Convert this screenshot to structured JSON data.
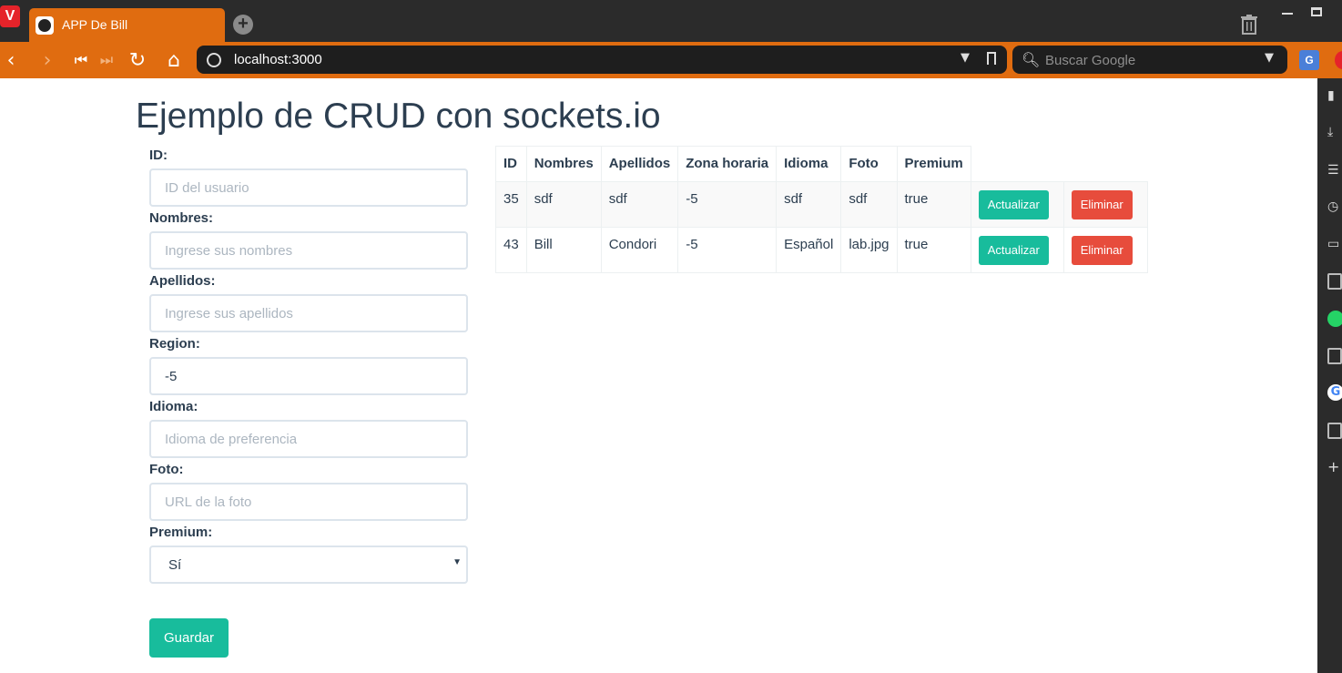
{
  "browser": {
    "tab_title": "APP De Bill",
    "url": "localhost:3000",
    "search_placeholder": "Buscar Google"
  },
  "page": {
    "title": "Ejemplo de CRUD con sockets.io"
  },
  "form": {
    "id": {
      "label": "ID:",
      "placeholder": "ID del usuario",
      "value": ""
    },
    "nombres": {
      "label": "Nombres:",
      "placeholder": "Ingrese sus nombres",
      "value": ""
    },
    "apellidos": {
      "label": "Apellidos:",
      "placeholder": "Ingrese sus apellidos",
      "value": ""
    },
    "region": {
      "label": "Region:",
      "placeholder": "",
      "value": "-5"
    },
    "idioma": {
      "label": "Idioma:",
      "placeholder": "Idioma de preferencia",
      "value": ""
    },
    "foto": {
      "label": "Foto:",
      "placeholder": "URL de la foto",
      "value": ""
    },
    "premium": {
      "label": "Premium:",
      "selected": "Sí"
    },
    "save_label": "Guardar"
  },
  "table": {
    "headers": [
      "ID",
      "Nombres",
      "Apellidos",
      "Zona horaria",
      "Idioma",
      "Foto",
      "Premium"
    ],
    "rows": [
      {
        "id": "35",
        "nombres": "sdf",
        "apellidos": "sdf",
        "zona": "-5",
        "idioma": "sdf",
        "foto": "sdf",
        "premium": "true"
      },
      {
        "id": "43",
        "nombres": "Bill",
        "apellidos": "Condori",
        "zona": "-5",
        "idioma": "Español",
        "foto": "lab.jpg",
        "premium": "true"
      }
    ],
    "update_label": "Actualizar",
    "delete_label": "Eliminar"
  },
  "colors": {
    "accent": "#18bc9c",
    "danger": "#e74c3c",
    "chrome": "#e06c10",
    "text": "#2c3e50"
  }
}
